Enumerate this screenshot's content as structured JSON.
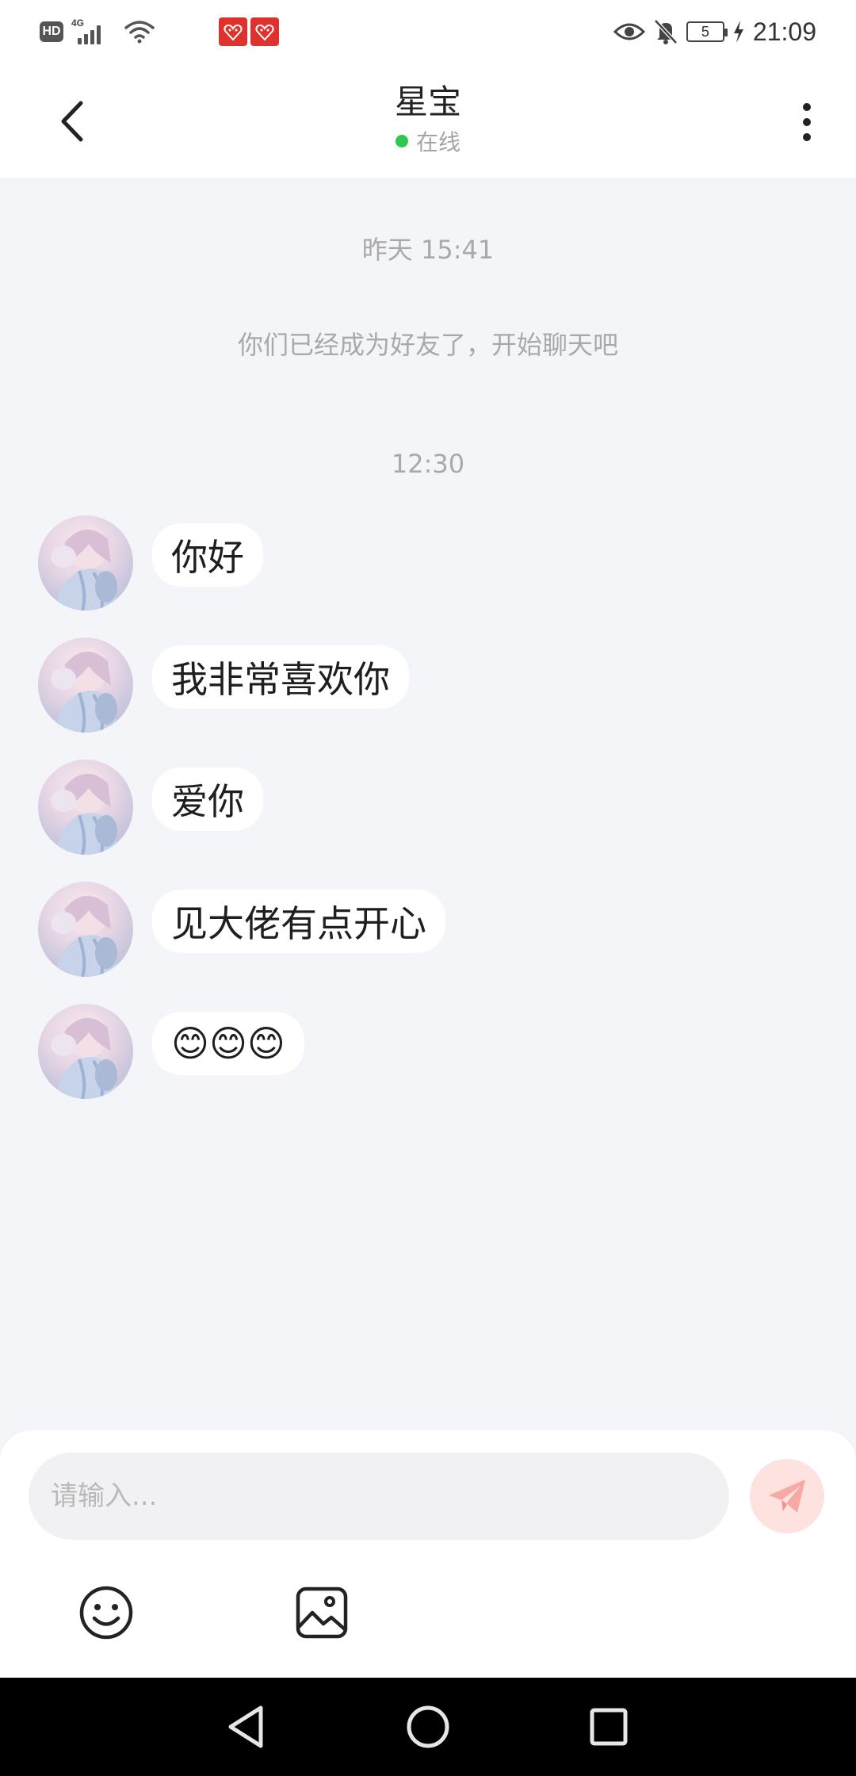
{
  "status_bar": {
    "hd": "HD",
    "network": "4G",
    "battery_level": "5",
    "time": "21:09",
    "icons": [
      "hd-icon",
      "signal-icon",
      "wifi-icon",
      "gift-icon",
      "gift-icon",
      "eye-icon",
      "mute-bell-icon",
      "battery-icon",
      "charging-icon"
    ]
  },
  "header": {
    "contact_name": "星宝",
    "status_text": "在线",
    "status_color": "#2fc94f"
  },
  "messages": {
    "timestamp_1": "昨天 15:41",
    "system_note": "你们已经成为好友了，开始聊天吧",
    "timestamp_2": "12:30",
    "items": [
      {
        "text": "你好"
      },
      {
        "text": "我非常喜欢你"
      },
      {
        "text": "爱你"
      },
      {
        "text": "见大佬有点开心"
      },
      {
        "text": "😊😊😊"
      }
    ]
  },
  "input": {
    "placeholder": "请输入...",
    "value": ""
  },
  "colors": {
    "background": "#f4f5f9",
    "send_button": "#fde2e0",
    "send_icon": "#f7a9a4"
  }
}
